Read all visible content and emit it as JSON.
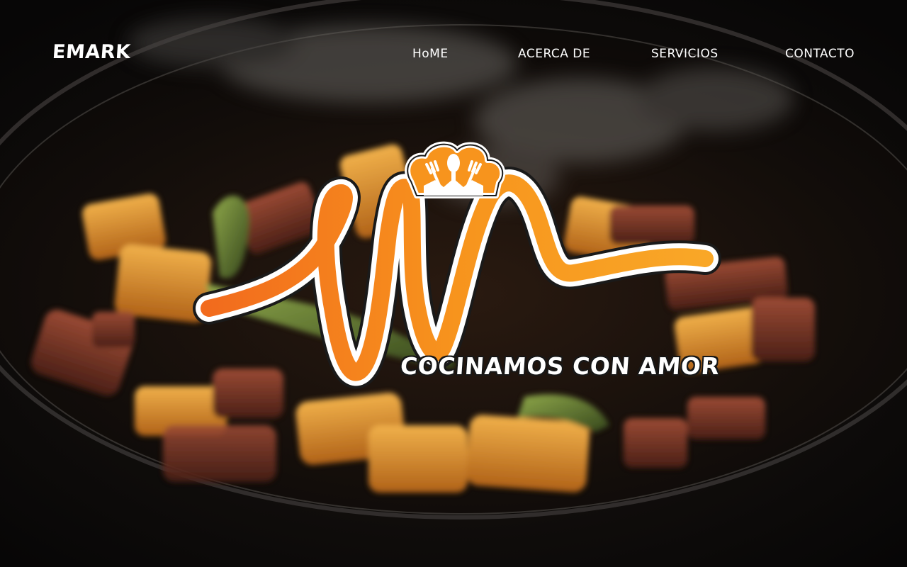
{
  "brand": {
    "name": "EMARK"
  },
  "nav": {
    "items": [
      {
        "label": "HoME"
      },
      {
        "label": "ACERCA DE"
      },
      {
        "label": "SERVICIOS"
      },
      {
        "label": "CONTACTO"
      }
    ]
  },
  "hero": {
    "tagline": "COCINAMOS CON AMOR",
    "background_image": "food-pan-photo",
    "logo_icon": "chef-hat-m-logo"
  },
  "colors": {
    "logo_orange": "#f7941d",
    "logo_orange_dark": "#ef6a1a",
    "text": "#ffffff",
    "background": "#0c0a09"
  }
}
